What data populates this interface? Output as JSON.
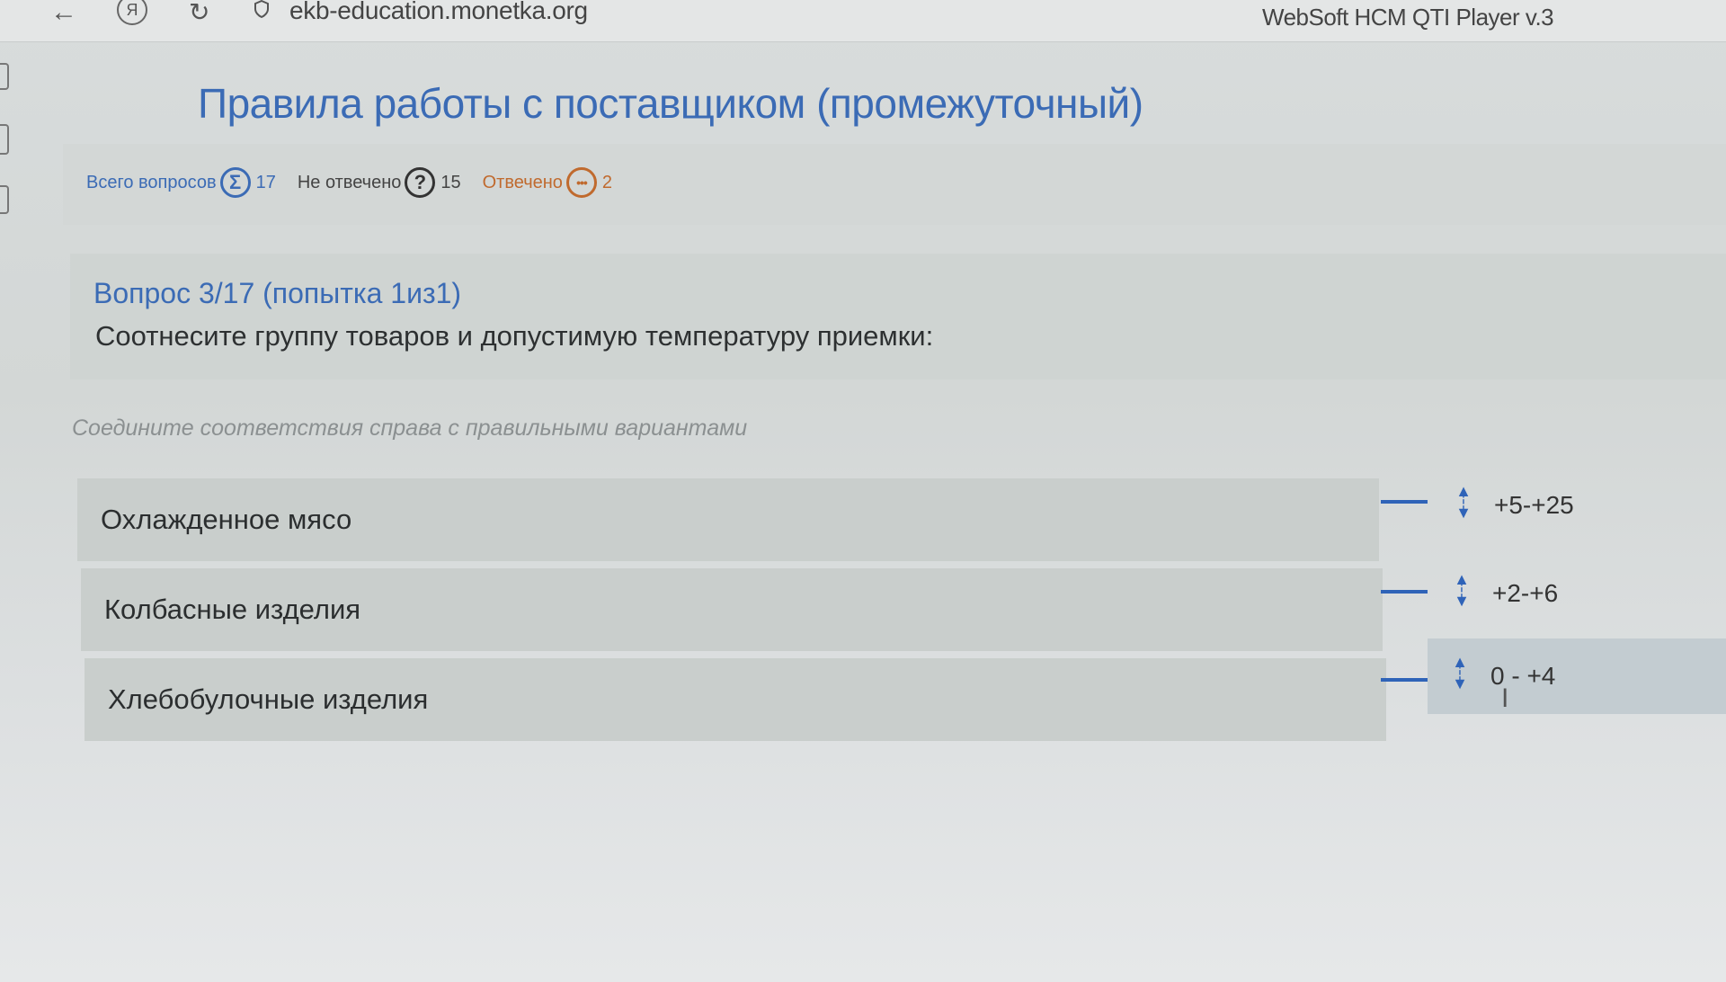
{
  "browser": {
    "url": "ekb-education.monetka.org",
    "app_title": "WebSoft HCM QTI Player v.3",
    "ya_label": "Я"
  },
  "header": {
    "title": "Правила работы с поставщиком (промежуточный)"
  },
  "stats": {
    "total_label": "Всего вопросов",
    "total_symbol": "Σ",
    "total_count": "17",
    "unanswered_label": "Не отвечено",
    "unanswered_symbol": "?",
    "unanswered_count": "15",
    "answered_label": "Отвечено",
    "answered_symbol": "•••",
    "answered_count": "2"
  },
  "question": {
    "number_line": "Вопрос 3/17  (попытка 1из1)",
    "text": "Соотнесите группу товаров и допустимую температуру приемки:",
    "instruction": "Соедините соответствия справа с правильными вариантами"
  },
  "matching": {
    "left": [
      {
        "label": "Охлажденное мясо"
      },
      {
        "label": "Колбасные изделия"
      },
      {
        "label": "Хлебобулочные изделия"
      }
    ],
    "right": [
      {
        "label": "+5-+25"
      },
      {
        "label": "+2-+6"
      },
      {
        "label": "0 - +4"
      }
    ]
  },
  "colors": {
    "accent": "#3b6bb5",
    "answered": "#c06a2e",
    "connector": "#2f63b8"
  },
  "icons": [
    "back-icon",
    "ya-icon",
    "reload-icon",
    "shield-icon",
    "sum-icon",
    "question-icon",
    "ellipsis-icon",
    "drag-handle-icon",
    "text-cursor-icon"
  ]
}
